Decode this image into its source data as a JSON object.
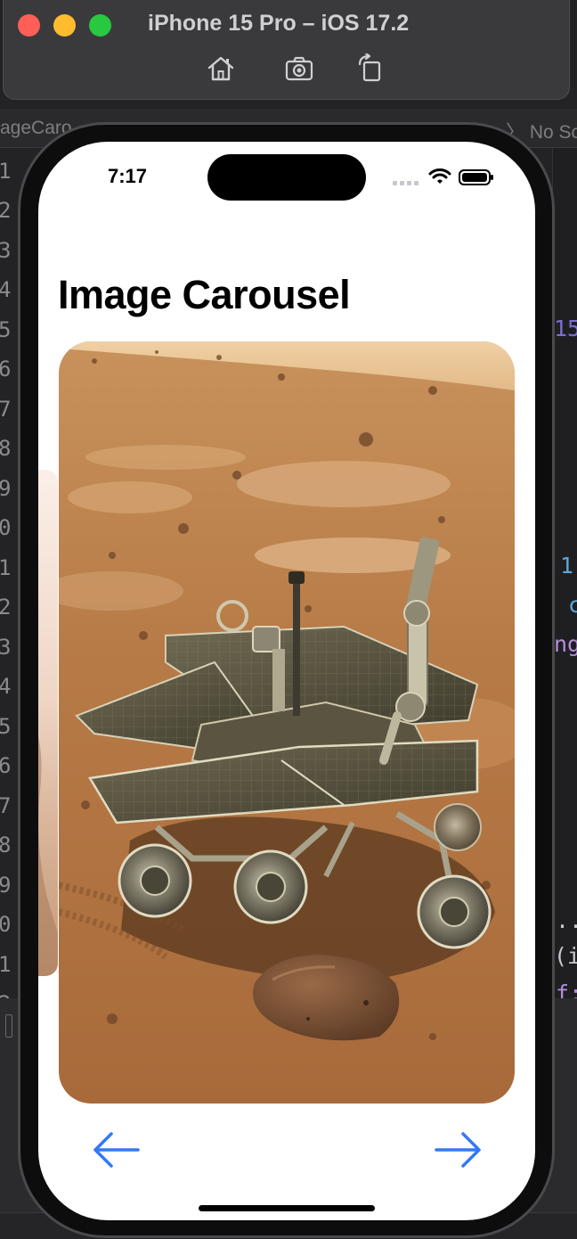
{
  "simulator": {
    "title": "iPhone 15 Pro – iOS 17.2",
    "toolbar": [
      "home-icon",
      "screenshot-icon",
      "rotate-icon"
    ]
  },
  "xcode": {
    "breadcrumb_left": "ageCaro",
    "breadcrumb_right": "〉 No Sc",
    "line_numbers": [
      "1",
      "2",
      "3",
      "4",
      "5",
      "6",
      "7",
      "8",
      "9",
      "0",
      "1",
      "2",
      "3",
      "4",
      "5",
      "6",
      "7",
      "8",
      "9",
      "0",
      "1",
      "2"
    ],
    "code_fragments": [
      "15",
      ":1",
      "c",
      "ng",
      "..",
      "(i",
      "f:"
    ]
  },
  "app": {
    "status_time": "7:17",
    "title": "Image Carousel",
    "current_image": "mars-rover-photo",
    "prev_image": "mars-landscape-photo"
  },
  "colors": {
    "accent": "#3478f6",
    "mars_sky": "#e7c59a",
    "mars_ground": "#b57a45"
  }
}
